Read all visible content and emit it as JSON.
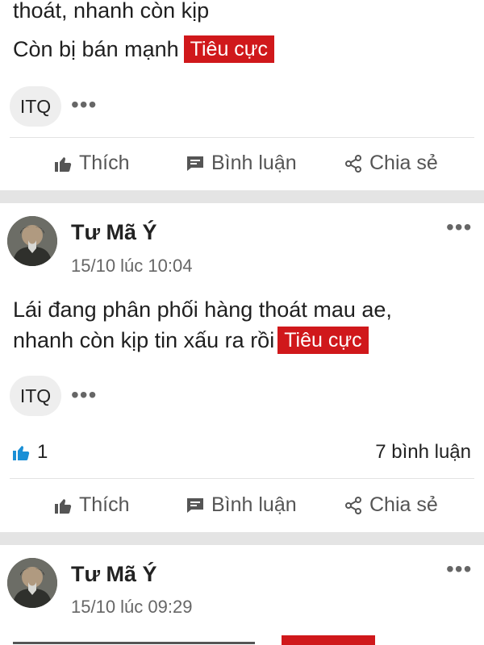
{
  "post0": {
    "line1": "thoát, nhanh còn kịp",
    "line2": "Còn bị bán mạnh",
    "tag": "Tiêu cực",
    "chip": "ITQ",
    "more": "•••"
  },
  "actions": {
    "like": "Thích",
    "comment": "Bình luận",
    "share": "Chia sẻ"
  },
  "post1": {
    "author": "Tư Mã Ý",
    "time": "15/10 lúc 10:04",
    "line1": "Lái đang phân phối hàng thoát mau ae,",
    "line2": "nhanh còn kịp tin xấu ra rồi",
    "tag": "Tiêu cực",
    "chip": "ITQ",
    "likes": "1",
    "comments": "7 bình luận",
    "more": "•••"
  },
  "post2": {
    "author": "Tư Mã Ý",
    "time": "15/10 lúc 09:29",
    "more": "•••"
  },
  "colors": {
    "negative_tag": "#d0181b",
    "like_blue": "#1a8fd6"
  },
  "icons": [
    "thumbs-up-icon",
    "comment-icon",
    "share-icon",
    "more-icon",
    "avatar"
  ]
}
